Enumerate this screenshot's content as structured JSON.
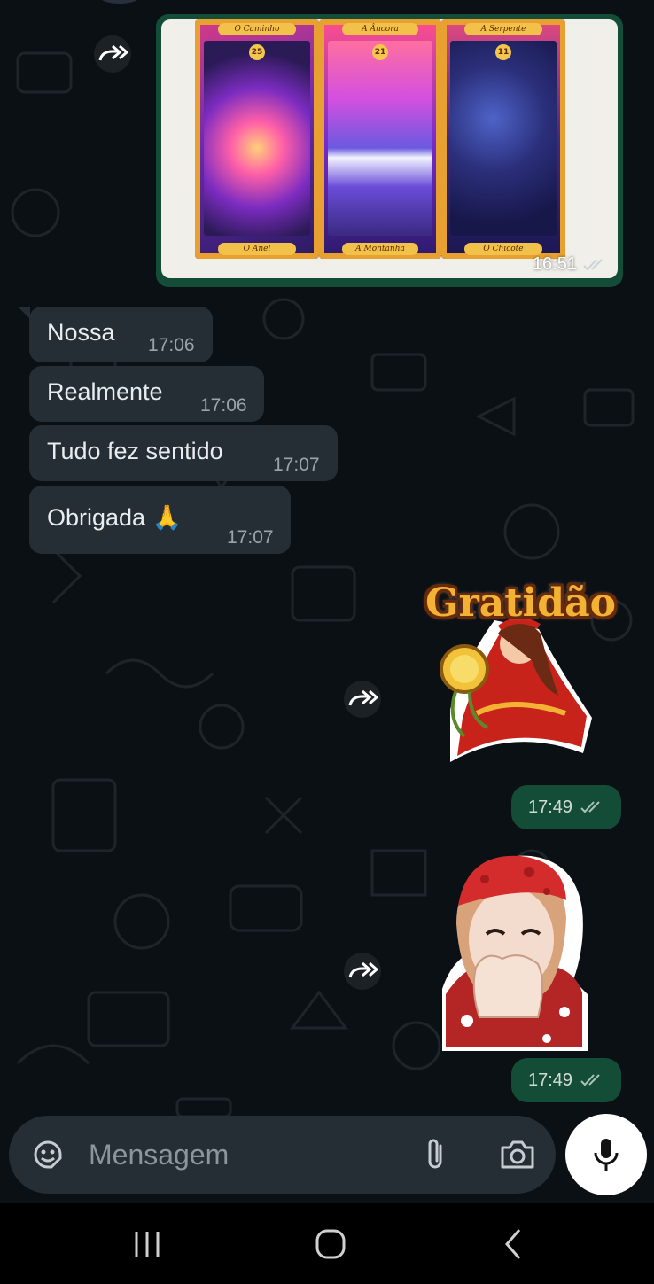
{
  "messages": {
    "image_time": "16:51",
    "incoming": [
      {
        "text": "Nossa",
        "time": "17:06"
      },
      {
        "text": "Realmente",
        "time": "17:06"
      },
      {
        "text": "Tudo fez sentido",
        "time": "17:07"
      },
      {
        "text": "Obrigada 🙏",
        "time": "17:07"
      }
    ],
    "sticker1_text": "Gratidão",
    "sticker1_time": "17:49",
    "sticker2_time": "17:49"
  },
  "cards": {
    "top_labels": [
      "O Caminho",
      "A Âncora",
      "A Serpente"
    ],
    "numbers": [
      "25",
      "21",
      "11"
    ],
    "bottom_labels": [
      "O Anel",
      "A Montanha",
      "O Chicote"
    ]
  },
  "composer": {
    "placeholder": "Mensagem",
    "emoji_icon": "sticker-icon",
    "attach_icon": "paperclip-icon",
    "camera_icon": "camera-icon",
    "mic_icon": "microphone-icon"
  },
  "colors": {
    "background": "#0b1014",
    "incoming_bubble": "#242e34",
    "outgoing_bubble": "#144d37",
    "read_ticks": "#a9c2b8"
  }
}
